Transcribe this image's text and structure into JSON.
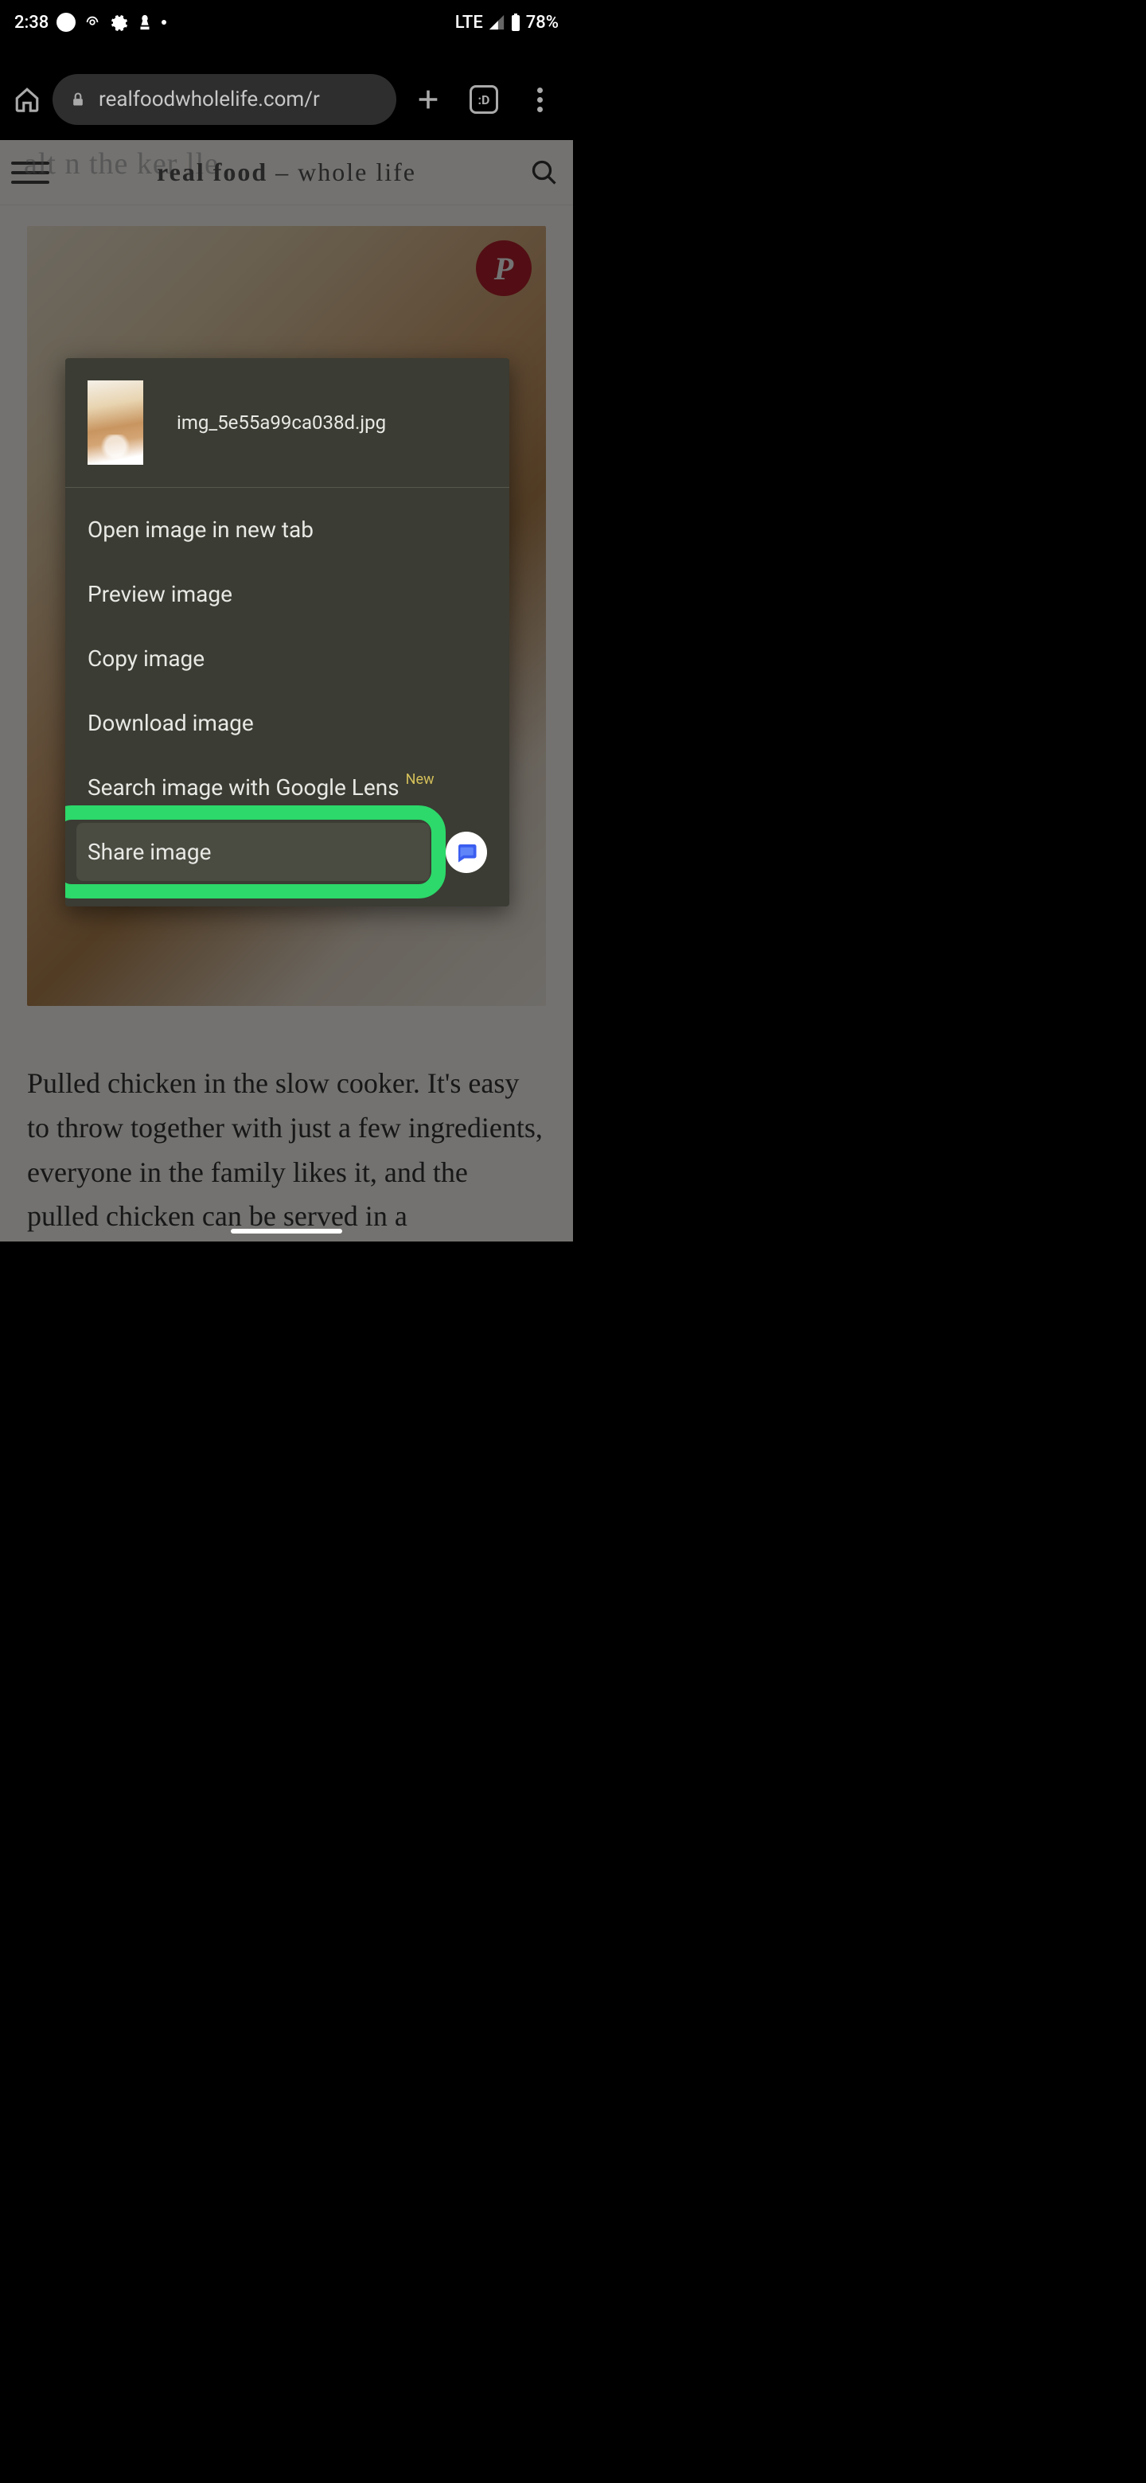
{
  "status": {
    "time": "2:38",
    "network": "LTE",
    "battery": "78%"
  },
  "browser": {
    "url": "realfoodwholelife.com/r",
    "tab_label": ":D"
  },
  "site": {
    "logo_bold": "real food",
    "logo_sep": " – ",
    "logo_rest": "whole life",
    "title_fragment": "alt   n the     ker     lle"
  },
  "article": {
    "excerpt": "Pulled chicken in the slow cooker. It's easy to throw together with just a few ingredients, everyone in the family likes it, and the pulled chicken can be served in a"
  },
  "menu": {
    "filename": "img_5e55a99ca038d.jpg",
    "open_new_tab": "Open image in new tab",
    "preview": "Preview image",
    "copy": "Copy image",
    "download": "Download image",
    "search_lens": "Search image with Google Lens",
    "new_badge": "New",
    "share": "Share image"
  },
  "pinterest_glyph": "P"
}
